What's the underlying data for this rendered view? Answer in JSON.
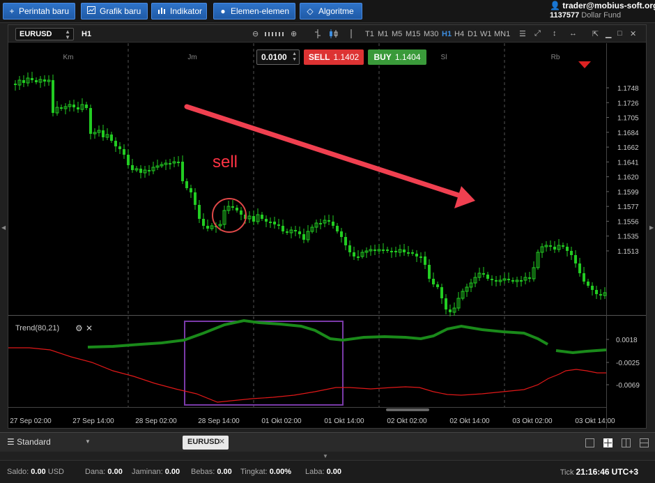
{
  "toolbar": {
    "new_order": "Perintah baru",
    "new_chart": "Grafik baru",
    "indicator": "Indikator",
    "elements": "Elemen-elemen",
    "algorithm": "Algoritme"
  },
  "account": {
    "user": "trader@mobius-soft.org",
    "number": "1137577",
    "fund": "Dollar Fund"
  },
  "chart": {
    "symbol": "EURUSD",
    "timeframe": "H1",
    "timeframes": [
      "T1",
      "M1",
      "M5",
      "M15",
      "M30",
      "H1",
      "H4",
      "D1",
      "W1",
      "MN1"
    ],
    "active_timeframe": "H1",
    "day_labels": [
      "Km",
      "Jm",
      "Sl",
      "Rb"
    ],
    "price_ticks": [
      "1.1748",
      "1.1726",
      "1.1705",
      "1.1684",
      "1.1662",
      "1.1641",
      "1.1620",
      "1.1599",
      "1.1577",
      "1.1556",
      "1.1535",
      "1.1513"
    ],
    "indicator_ticks": [
      "0.0018",
      "-0.0025",
      "-0.0069"
    ],
    "time_ticks": [
      "27 Sep 02:00",
      "27 Sep 14:00",
      "28 Sep 02:00",
      "28 Sep 14:00",
      "01 Okt 02:00",
      "01 Okt 14:00",
      "02 Okt 02:00",
      "02 Okt 14:00",
      "03 Okt 02:00",
      "03 Okt 14:00"
    ],
    "indicator_name": "Trend(80,21)",
    "annotation": "sell",
    "colors": {
      "bull": "#22cc22",
      "arrow": "#f04050",
      "circle": "#e04848",
      "box": "#7a3aa8",
      "indicator_up": "#1a8a1a",
      "indicator_down": "#e01818"
    }
  },
  "ticket": {
    "lot": "0.0100",
    "sell_label": "SELL",
    "sell_price": "1.1402",
    "buy_label": "BUY",
    "buy_price": "1.1404"
  },
  "tabs": {
    "workspace": "Standard",
    "chart_tab": "EURUSD"
  },
  "status": {
    "balance_label": "Saldo:",
    "balance_value": "0.00",
    "balance_ccy": "USD",
    "equity_label": "Dana:",
    "equity_value": "0.00",
    "margin_label": "Jaminan:",
    "margin_value": "0.00",
    "free_label": "Bebas:",
    "free_value": "0.00",
    "level_label": "Tingkat:",
    "level_value": "0.00%",
    "profit_label": "Laba:",
    "profit_value": "0.00",
    "tick_label": "Tick",
    "tick_time": "21:16:46",
    "timezone": "UTC+3"
  }
}
